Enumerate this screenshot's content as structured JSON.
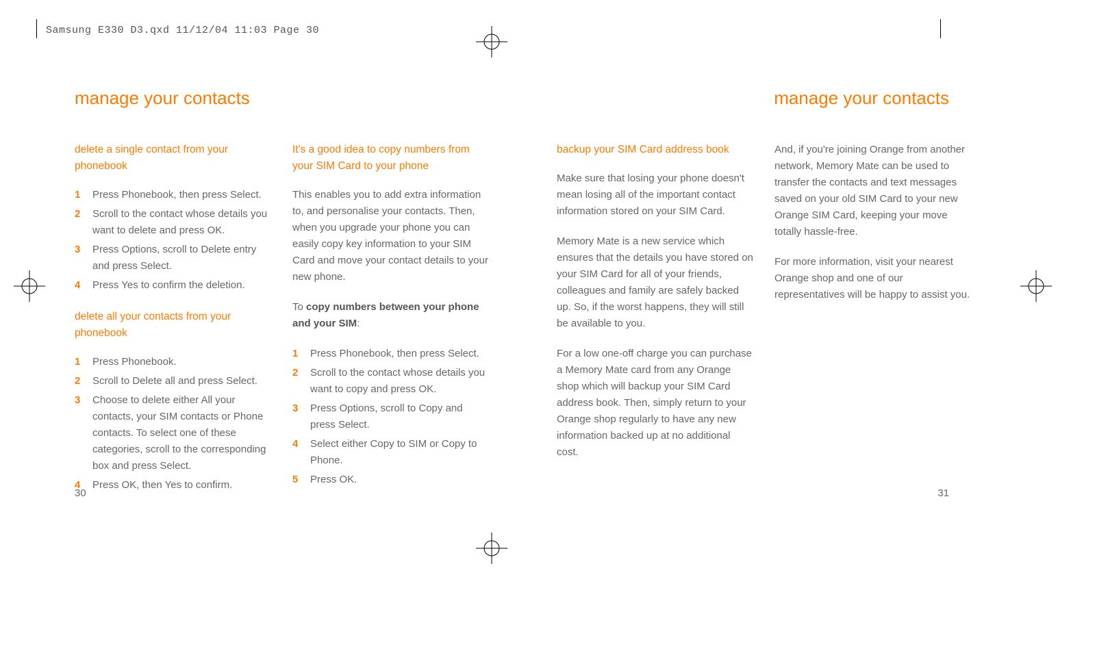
{
  "slug": "Samsung E330 D3.qxd  11/12/04  11:03  Page 30",
  "titles": {
    "left": "manage your contacts",
    "right": "manage your contacts"
  },
  "pageNumbers": {
    "left": "30",
    "right": "31"
  },
  "col1": {
    "h1": "delete a single contact from your phonebook",
    "list1": [
      "Press Phonebook, then press Select.",
      "Scroll to the contact whose details you want to delete and press OK.",
      "Press Options, scroll to Delete entry and press Select.",
      "Press Yes to confirm the deletion."
    ],
    "h2": "delete all your contacts from your phonebook",
    "list2": [
      "Press Phonebook.",
      "Scroll to Delete all and press Select.",
      "Choose to delete either All your contacts, your SIM contacts or Phone contacts. To select one of these categories, scroll to the corresponding box and press Select.",
      "Press OK, then Yes to confirm."
    ]
  },
  "col2": {
    "h1": "It's a good idea to copy numbers from your SIM Card to your phone",
    "p1": "This enables you to add extra information to, and personalise your contacts. Then, when you upgrade your phone you can easily copy key information to your SIM Card and move your contact details to your new phone.",
    "lead_pre": "To ",
    "lead_bold": "copy numbers between your phone and your SIM",
    "lead_post": ":",
    "list1": [
      "Press Phonebook, then press Select.",
      "Scroll to the contact whose details you want to copy and press OK.",
      "Press Options, scroll to Copy and press Select.",
      "Select either Copy to SIM or Copy to Phone.",
      "Press OK."
    ]
  },
  "col3": {
    "h1": "backup your SIM Card address book",
    "p1": "Make sure that losing your phone doesn't mean losing all of the important contact information stored on your SIM Card.",
    "p2": "Memory Mate is a new service which ensures that the details you have stored on your SIM Card for all of your friends, colleagues and family are safely backed up. So, if the worst happens, they will still be available to you.",
    "p3": "For a low one-off charge you can purchase a Memory Mate card from any Orange shop which will backup your SIM Card address book. Then, simply return to your Orange shop regularly to have any new information backed up at no additional cost."
  },
  "col4": {
    "p1": "And, if you're joining Orange from another network, Memory Mate can be used to transfer the contacts and text messages saved on your old SIM Card to your new Orange SIM Card, keeping your move totally hassle-free.",
    "p2": "For more information, visit your nearest Orange shop and one of our representatives will be happy to assist you."
  }
}
